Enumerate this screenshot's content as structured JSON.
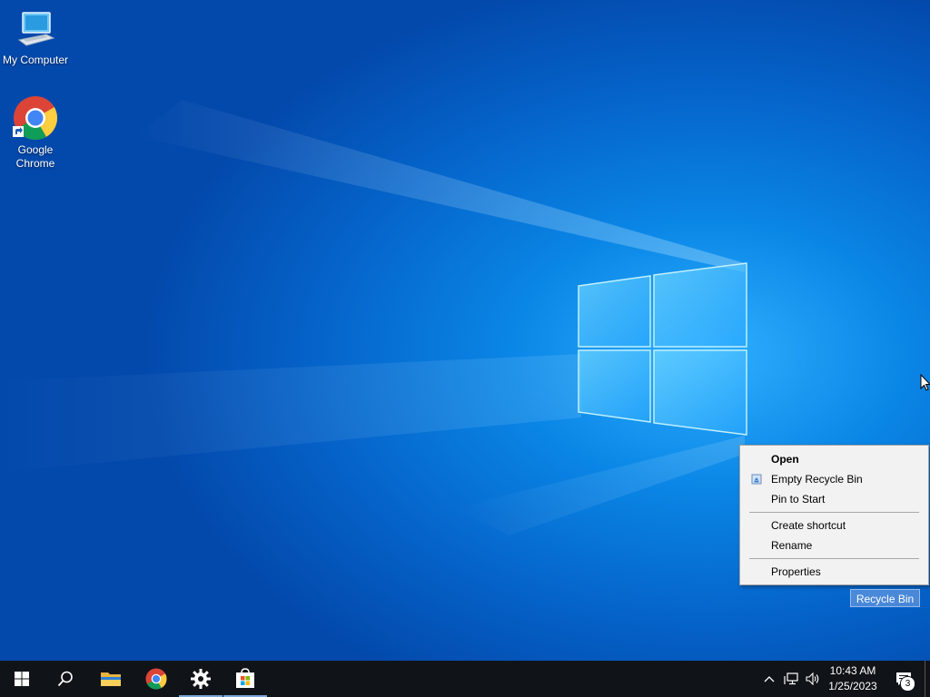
{
  "desktop": {
    "icons": [
      {
        "label": "My Computer"
      },
      {
        "label": "Google\nChrome",
        "line1": "Google",
        "line2": "Chrome"
      }
    ],
    "selected_icon_label": "Recycle Bin"
  },
  "context_menu": {
    "items": [
      {
        "label": "Open",
        "bold": true
      },
      {
        "label": "Empty Recycle Bin",
        "icon": "recycle-bin-icon"
      },
      {
        "label": "Pin to Start"
      },
      {
        "label": "Create shortcut"
      },
      {
        "label": "Rename"
      },
      {
        "label": "Properties"
      }
    ]
  },
  "taskbar": {
    "buttons": [
      {
        "name": "start",
        "icon": "windows-logo-icon"
      },
      {
        "name": "search",
        "icon": "search-icon"
      },
      {
        "name": "file-explorer",
        "icon": "folder-icon"
      },
      {
        "name": "chrome",
        "icon": "chrome-icon"
      },
      {
        "name": "settings",
        "icon": "gear-icon"
      },
      {
        "name": "store",
        "icon": "store-icon"
      }
    ],
    "clock": {
      "time": "10:43 AM",
      "date": "1/25/2023"
    },
    "notification_count": "3"
  },
  "colors": {
    "taskbar_bg": "#101418",
    "accent": "#0a86e6"
  }
}
